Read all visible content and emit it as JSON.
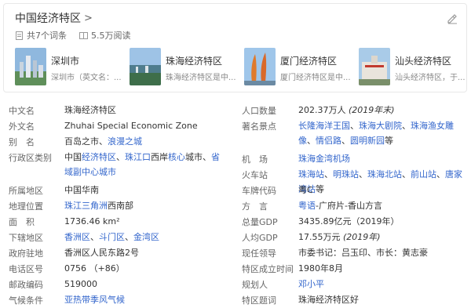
{
  "card": {
    "title": "中国经济特区",
    "count_label": "共7个词条",
    "views_label": "5.5万阅读",
    "entries": [
      {
        "name": "深圳市",
        "desc": "深圳市（英文名：..."
      },
      {
        "name": "珠海经济特区",
        "desc": "珠海经济特区是中..."
      },
      {
        "name": "厦门经济特区",
        "desc": "厦门经济特区是中..."
      },
      {
        "name": "汕头经济特区",
        "desc": "汕头经济特区，于..."
      }
    ]
  },
  "info": {
    "left": [
      {
        "label": "中文名",
        "parts": [
          {
            "t": "珠海经济特区"
          }
        ]
      },
      {
        "label": "外文名",
        "parts": [
          {
            "t": "Zhuhai Special Economic Zone"
          }
        ]
      },
      {
        "label": "别　名",
        "parts": [
          {
            "t": "百岛之市、"
          },
          {
            "t": "浪漫之城",
            "link": true
          }
        ]
      },
      {
        "label": "行政区类别",
        "parts": [
          {
            "t": "中国"
          },
          {
            "t": "经济特区",
            "link": true
          },
          {
            "t": "、"
          },
          {
            "t": "珠江口",
            "link": true
          },
          {
            "t": "西岸"
          },
          {
            "t": "核心",
            "link": true
          },
          {
            "t": "城市、"
          },
          {
            "t": "省域副中心城市",
            "link": true
          }
        ],
        "tall": true
      },
      {
        "label": "所属地区",
        "parts": [
          {
            "t": "中国华南"
          }
        ]
      },
      {
        "label": "地理位置",
        "parts": [
          {
            "t": "珠江三角洲",
            "link": true
          },
          {
            "t": "西南部"
          }
        ]
      },
      {
        "label": "面　积",
        "parts": [
          {
            "t": "1736.46 km²"
          }
        ]
      },
      {
        "label": "下辖地区",
        "parts": [
          {
            "t": "香洲区",
            "link": true
          },
          {
            "t": "、"
          },
          {
            "t": "斗门区",
            "link": true
          },
          {
            "t": "、"
          },
          {
            "t": "金湾区",
            "link": true
          }
        ]
      },
      {
        "label": "政府驻地",
        "parts": [
          {
            "t": "香洲区人民东路2号"
          }
        ]
      },
      {
        "label": "电话区号",
        "parts": [
          {
            "t": "0756 （+86）"
          }
        ]
      },
      {
        "label": "邮政编码",
        "parts": [
          {
            "t": "519000"
          }
        ]
      },
      {
        "label": "气候条件",
        "parts": [
          {
            "t": "亚热带季风气候",
            "link": true
          }
        ]
      }
    ],
    "right": [
      {
        "label": "人口数量",
        "parts": [
          {
            "t": "202.37万人 "
          },
          {
            "t": "(2019年末)",
            "italic": true
          }
        ]
      },
      {
        "label": "著名景点",
        "parts": [
          {
            "t": "长隆海洋王国",
            "link": true
          },
          {
            "t": "、"
          },
          {
            "t": "珠海大剧院",
            "link": true
          },
          {
            "t": "、"
          },
          {
            "t": "珠海渔女雕像",
            "link": true
          },
          {
            "t": "、"
          },
          {
            "t": "情侣路",
            "link": true
          },
          {
            "t": "、"
          },
          {
            "t": "圆明新园",
            "link": true
          },
          {
            "t": "等"
          }
        ],
        "tall": true
      },
      {
        "label": "机　场",
        "parts": [
          {
            "t": "珠海金湾机场",
            "link": true
          }
        ]
      },
      {
        "label": "火车站",
        "parts": [
          {
            "t": "珠海站",
            "link": true
          },
          {
            "t": "、"
          },
          {
            "t": "明珠站",
            "link": true
          },
          {
            "t": "、"
          },
          {
            "t": "珠海北站",
            "link": true
          },
          {
            "t": "、"
          },
          {
            "t": "前山站",
            "link": true
          },
          {
            "t": "、"
          },
          {
            "t": "唐家湾站",
            "link": true
          },
          {
            "t": "等"
          }
        ]
      },
      {
        "label": "车牌代码",
        "parts": [
          {
            "t": "粤C"
          }
        ]
      },
      {
        "label": "方　言",
        "parts": [
          {
            "t": "粤语",
            "link": true
          },
          {
            "t": "-广府片-香山方言"
          }
        ]
      },
      {
        "label": "总量GDP",
        "parts": [
          {
            "t": "3435.89亿元（2019年）"
          }
        ]
      },
      {
        "label": "人均GDP",
        "parts": [
          {
            "t": "17.55万元 "
          },
          {
            "t": "(2019年)",
            "italic": true
          }
        ]
      },
      {
        "label": "现任领导",
        "parts": [
          {
            "t": "市委书记：吕玉印、市长：黄志豪"
          }
        ]
      },
      {
        "label": "特区成立时间",
        "parts": [
          {
            "t": "1980年8月"
          }
        ]
      },
      {
        "label": "规划人",
        "parts": [
          {
            "t": "邓小平",
            "link": true
          }
        ]
      },
      {
        "label": "特区题词",
        "parts": [
          {
            "t": "珠海经济特区好"
          }
        ]
      }
    ]
  },
  "colors": {
    "link": "#3366cc",
    "label": "#666666",
    "text": "#333333"
  }
}
